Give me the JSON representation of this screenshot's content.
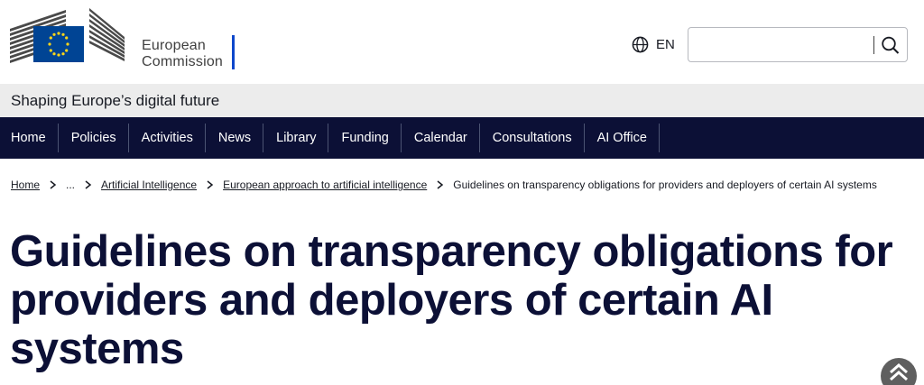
{
  "header": {
    "logo_line1": "European",
    "logo_line2": "Commission",
    "language": "EN",
    "search": {
      "value": "",
      "placeholder": ""
    }
  },
  "site": {
    "name": "Shaping Europe’s digital future"
  },
  "nav": {
    "items": [
      {
        "label": "Home"
      },
      {
        "label": "Policies"
      },
      {
        "label": "Activities"
      },
      {
        "label": "News"
      },
      {
        "label": "Library"
      },
      {
        "label": "Funding"
      },
      {
        "label": "Calendar"
      },
      {
        "label": "Consultations"
      },
      {
        "label": "AI Office"
      }
    ]
  },
  "breadcrumb": {
    "home": "Home",
    "ellipsis": "...",
    "item1": "Artificial Intelligence",
    "item2": "European approach to artificial intelligence",
    "current": "Guidelines on transparency obligations for providers and deployers of certain AI systems"
  },
  "page": {
    "title": "Guidelines on transparency obligations for providers and deployers of certain AI systems"
  },
  "colors": {
    "nav_background": "#0c1036",
    "brand_blue": "#0e47cb",
    "flag_blue": "#004494",
    "flag_stars": "#ffd617",
    "sitebar_background": "#ececec"
  },
  "icons": {
    "logo": "european-commission-logo",
    "language": "globe-icon",
    "search": "search-icon",
    "breadcrumb_separator": "chevron-right-icon",
    "back_to_top": "back-to-top-icon"
  }
}
